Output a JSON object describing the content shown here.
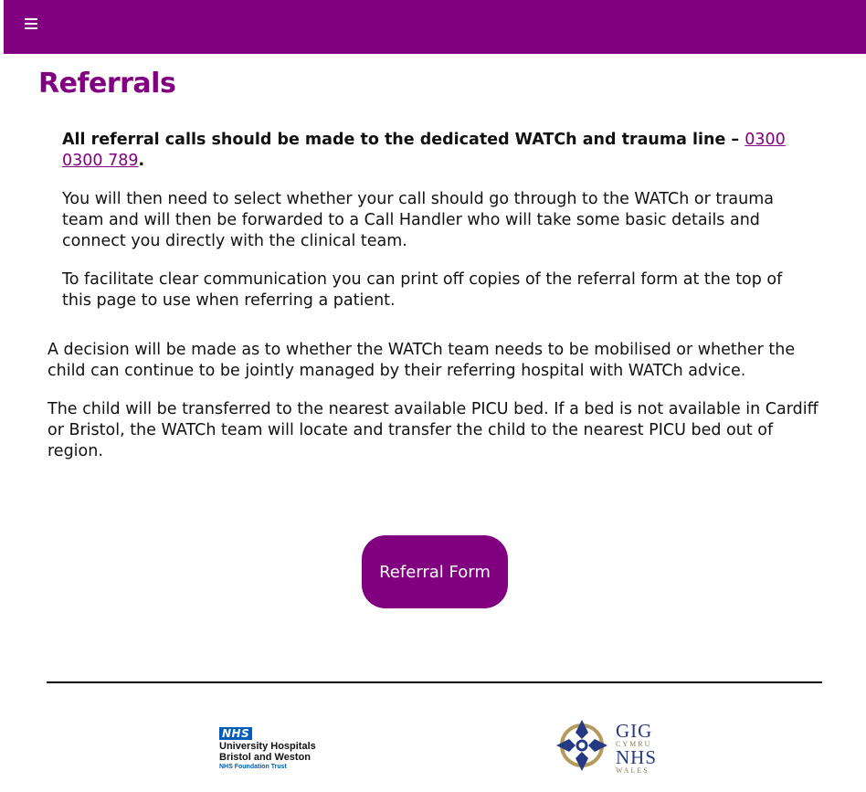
{
  "header": {
    "menu_icon": "hamburger-menu-icon",
    "background_color": "#800080"
  },
  "page": {
    "title": "Referrals",
    "accent_color": "#800080"
  },
  "intro": {
    "lead_text": "All referral calls should be made to the dedicated WATCh and trauma line – ",
    "phone_number": "0300 0300 789",
    "lead_end": ".",
    "paragraph_2": "You will then need to select whether your call should go through to the WATCh or trauma team and will then be forwarded to a Call Handler who will take some basic details and connect you directly with the clinical team.",
    "paragraph_3": "To facilitate clear communication you can print off copies of the referral form at the top of this page to use when referring a patient."
  },
  "body": {
    "paragraph_1": "A decision will be made as to whether the WATCh team needs to be mobilised or whether the child can continue to be jointly managed by their referring hospital with WATCh advice.",
    "paragraph_2": "The child will be transferred to the nearest available PICU bed. If a bed is not available in Cardiff or Bristol, the WATCh team will locate and transfer the child to the nearest PICU bed out of region."
  },
  "actions": {
    "referral_form_label": "Referral Form"
  },
  "footer": {
    "uhbw_logo": {
      "nhs": "NHS",
      "line1": "University Hospitals",
      "line2": "Bristol and Weston",
      "line3": "NHS Foundation Trust"
    },
    "wales_logo": {
      "gig": "GIG",
      "cymru": "CYMRU",
      "nhs": "NHS",
      "wales": "WALES"
    }
  }
}
